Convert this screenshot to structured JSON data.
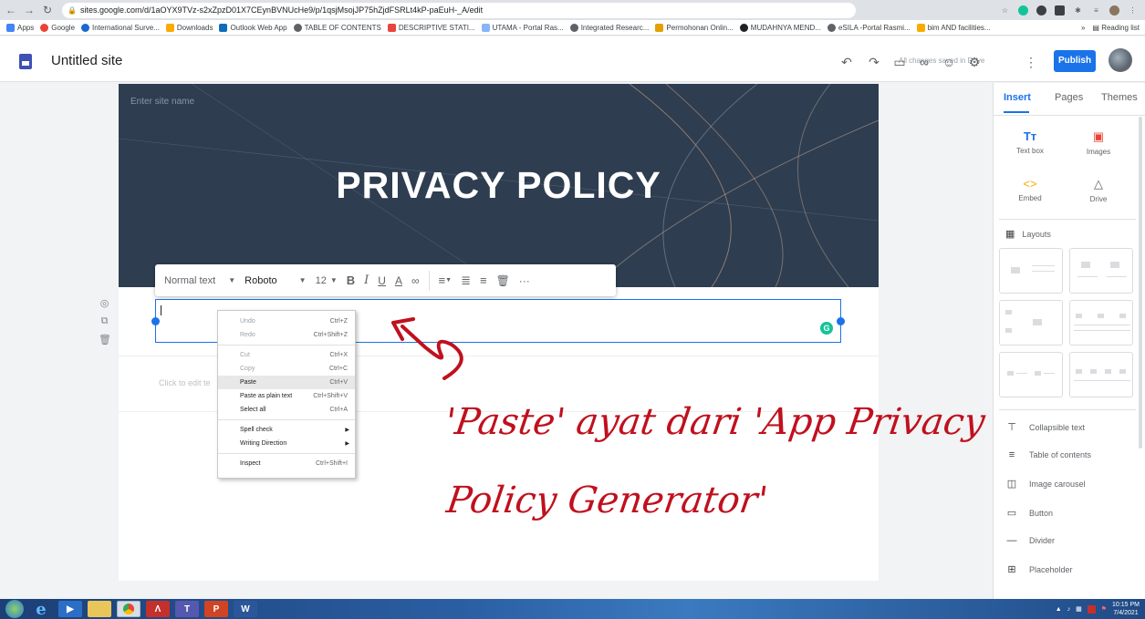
{
  "browser": {
    "url": "sites.google.com/d/1aOYX9TVz-s2xZpzD01X7CEynBVNUcHe9/p/1qsjMsojJP75hZjdFSRLt4kP-paEuH-_A/edit",
    "bookmarks": [
      "Apps",
      "Google",
      "International Surve...",
      "Downloads",
      "Outlook Web App",
      "TABLE OF CONTENTS",
      "DESCRIPTIVE STATI...",
      "UTAMA - Portal Ras...",
      "Integrated Researc...",
      "Permohonan Onlin...",
      "MUDAHNYA MEND...",
      "eSILA -Portal Rasmi...",
      "bim AND facilities..."
    ],
    "reading_list": "Reading list"
  },
  "header": {
    "site_title": "Untitled site",
    "saved_msg": "All changes saved in Drive",
    "publish_label": "Publish"
  },
  "canvas": {
    "site_name_placeholder": "Enter site name",
    "banner_title": "PRIVACY POLICY",
    "click_to_edit": "Click to edit te"
  },
  "toolbar": {
    "style": "Normal text",
    "font": "Roboto",
    "size": "12",
    "more": "···"
  },
  "context_menu": {
    "items": [
      {
        "label": "Undo",
        "shortcut": "Ctrl+Z"
      },
      {
        "label": "Redo",
        "shortcut": "Ctrl+Shift+Z"
      },
      {
        "label": "Cut",
        "shortcut": "Ctrl+X"
      },
      {
        "label": "Copy",
        "shortcut": "Ctrl+C"
      },
      {
        "label": "Paste",
        "shortcut": "Ctrl+V"
      },
      {
        "label": "Paste as plain text",
        "shortcut": "Ctrl+Shift+V"
      },
      {
        "label": "Select all",
        "shortcut": "Ctrl+A"
      },
      {
        "label": "Spell check",
        "shortcut": ""
      },
      {
        "label": "Writing Direction",
        "shortcut": ""
      },
      {
        "label": "Inspect",
        "shortcut": "Ctrl+Shift+I"
      }
    ]
  },
  "annotation": {
    "line1": "'Paste' ayat dari 'App Privacy",
    "line2": "Policy Generator'"
  },
  "panel": {
    "tabs": [
      "Insert",
      "Pages",
      "Themes"
    ],
    "insert_items": [
      "Text box",
      "Images",
      "Embed",
      "Drive"
    ],
    "layouts_label": "Layouts",
    "components": [
      "Collapsible text",
      "Table of contents",
      "Image carousel",
      "Button",
      "Divider",
      "Placeholder"
    ]
  },
  "taskbar": {
    "time": "10:15 PM",
    "date": "7/4/2021"
  },
  "colors": {
    "accent": "#1a73e8",
    "annotation": "#c0101e",
    "banner": "#2e3d50"
  }
}
